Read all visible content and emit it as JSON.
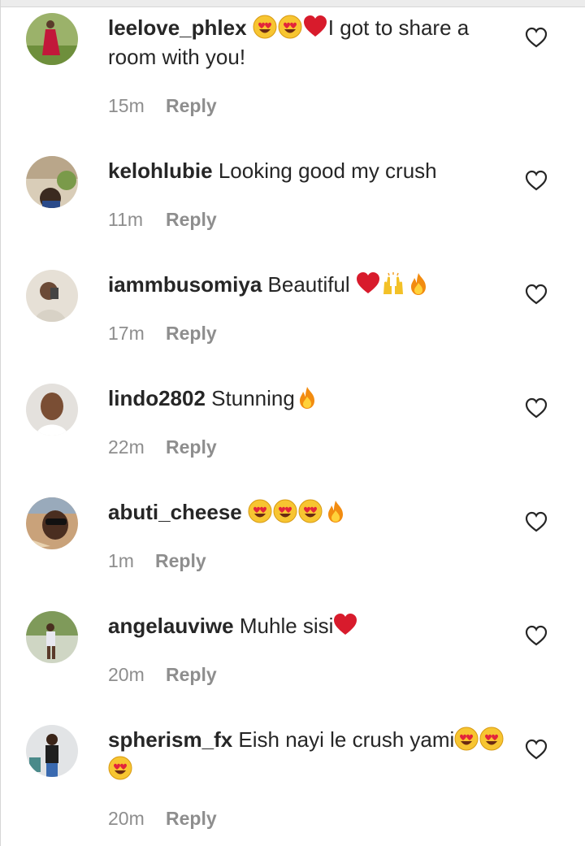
{
  "reply_label": "Reply",
  "comments": [
    {
      "username": "leelove_phlex",
      "emojis_before": [
        "heart-eyes",
        "heart-eyes",
        "red-heart"
      ],
      "text": "I got to share a room with you!",
      "emojis_after": [],
      "time": "15m"
    },
    {
      "username": "kelohlubie",
      "emojis_before": [],
      "text": "Looking good my crush",
      "emojis_after": [],
      "time": "11m"
    },
    {
      "username": "iammbusomiya",
      "emojis_before": [],
      "text": "Beautiful ",
      "emojis_after": [
        "red-heart",
        "raising-hands",
        "fire"
      ],
      "time": "17m"
    },
    {
      "username": "lindo2802",
      "emojis_before": [],
      "text": "Stunning",
      "emojis_after": [
        "fire"
      ],
      "time": "22m"
    },
    {
      "username": "abuti_cheese",
      "emojis_before": [],
      "text": "",
      "emojis_after": [
        "heart-eyes",
        "heart-eyes",
        "heart-eyes",
        "fire"
      ],
      "time": "1m"
    },
    {
      "username": "angelauviwe",
      "emojis_before": [],
      "text": "Muhle sisi",
      "emojis_after": [
        "red-heart"
      ],
      "time": "20m"
    },
    {
      "username": "spherism_fx",
      "emojis_before": [],
      "text": "Eish nayi le crush yami",
      "emojis_after": [
        "heart-eyes",
        "heart-eyes",
        "heart-eyes"
      ],
      "time": "20m"
    }
  ],
  "colors": {
    "text": "#262626",
    "secondary": "#8e8e8e",
    "background": "#ffffff"
  }
}
